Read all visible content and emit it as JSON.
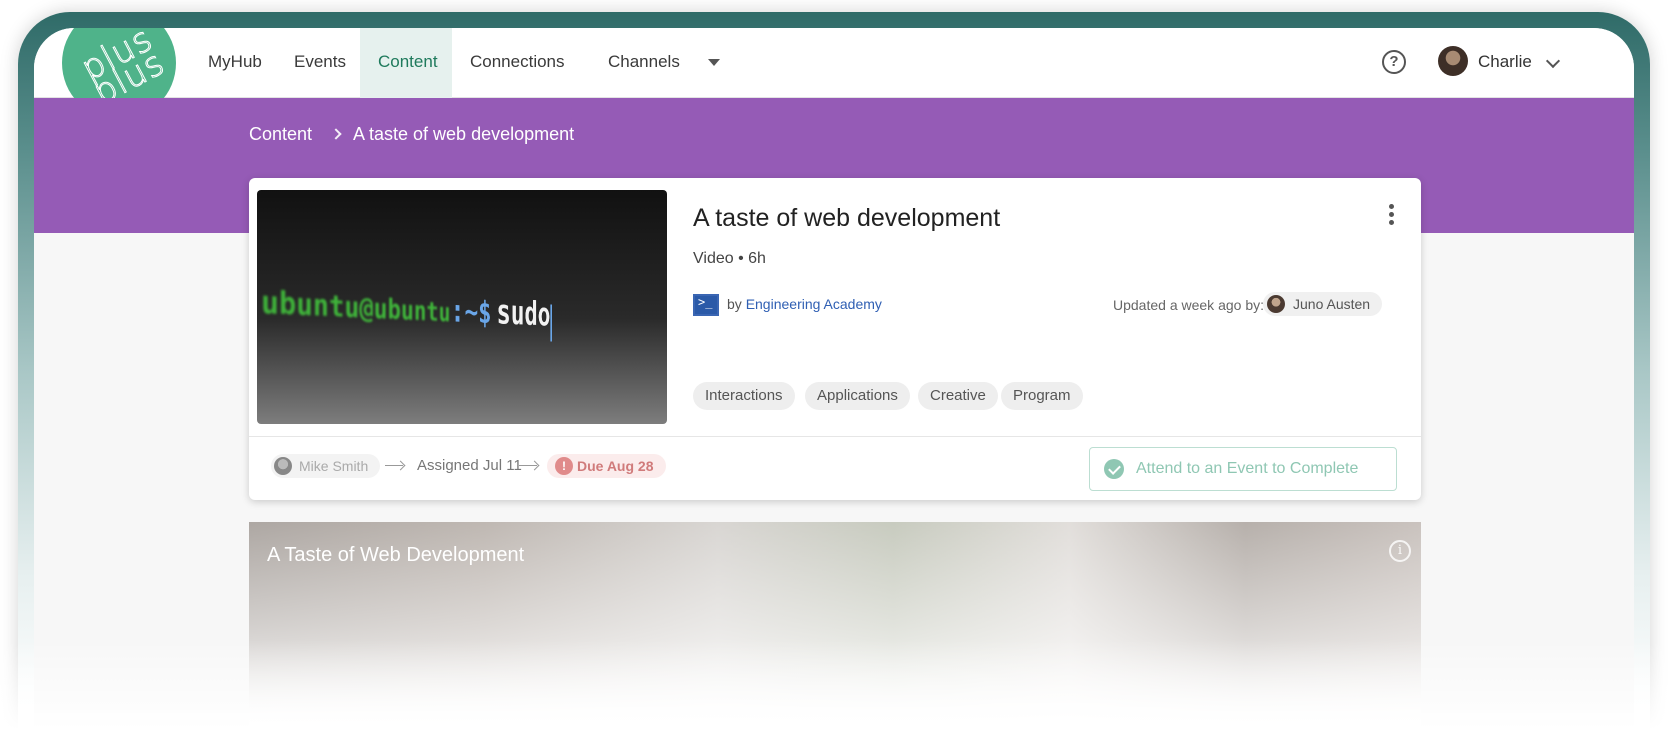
{
  "brand": {
    "logo_line1": "plus",
    "logo_line2": "plus"
  },
  "nav": {
    "items": [
      {
        "label": "MyHub"
      },
      {
        "label": "Events"
      },
      {
        "label": "Content"
      },
      {
        "label": "Connections"
      },
      {
        "label": "Channels"
      }
    ],
    "active": "Content",
    "help_icon": "question-circle-icon",
    "user_name": "Charlie"
  },
  "breadcrumb": {
    "root": "Content",
    "current": "A taste of web development"
  },
  "content": {
    "thumbnail_text": {
      "user": "ubuntu@ubuntu",
      "prompt": ":~$",
      "command": "sudo"
    },
    "title": "A taste of web development",
    "meta": "Video • 6h",
    "provider_prefix": "by",
    "provider": "Engineering Academy",
    "updated_label": "Updated a week ago by:",
    "updated_by": "Juno Austen",
    "tags": [
      "Interactions",
      "Applications",
      "Creative",
      "Program"
    ]
  },
  "assignment": {
    "assigner": "Mike Smith",
    "assigned": "Assigned Jul 11",
    "due": "Due Aug 28",
    "action": "Attend to an Event to Complete"
  },
  "banner": {
    "title": "A Taste of Web Development"
  },
  "colors": {
    "accent": "#1f7a5c",
    "band": "#955bb6",
    "link": "#2f5fb3",
    "due": "#d07b7b",
    "complete": "#8fc7b3"
  }
}
